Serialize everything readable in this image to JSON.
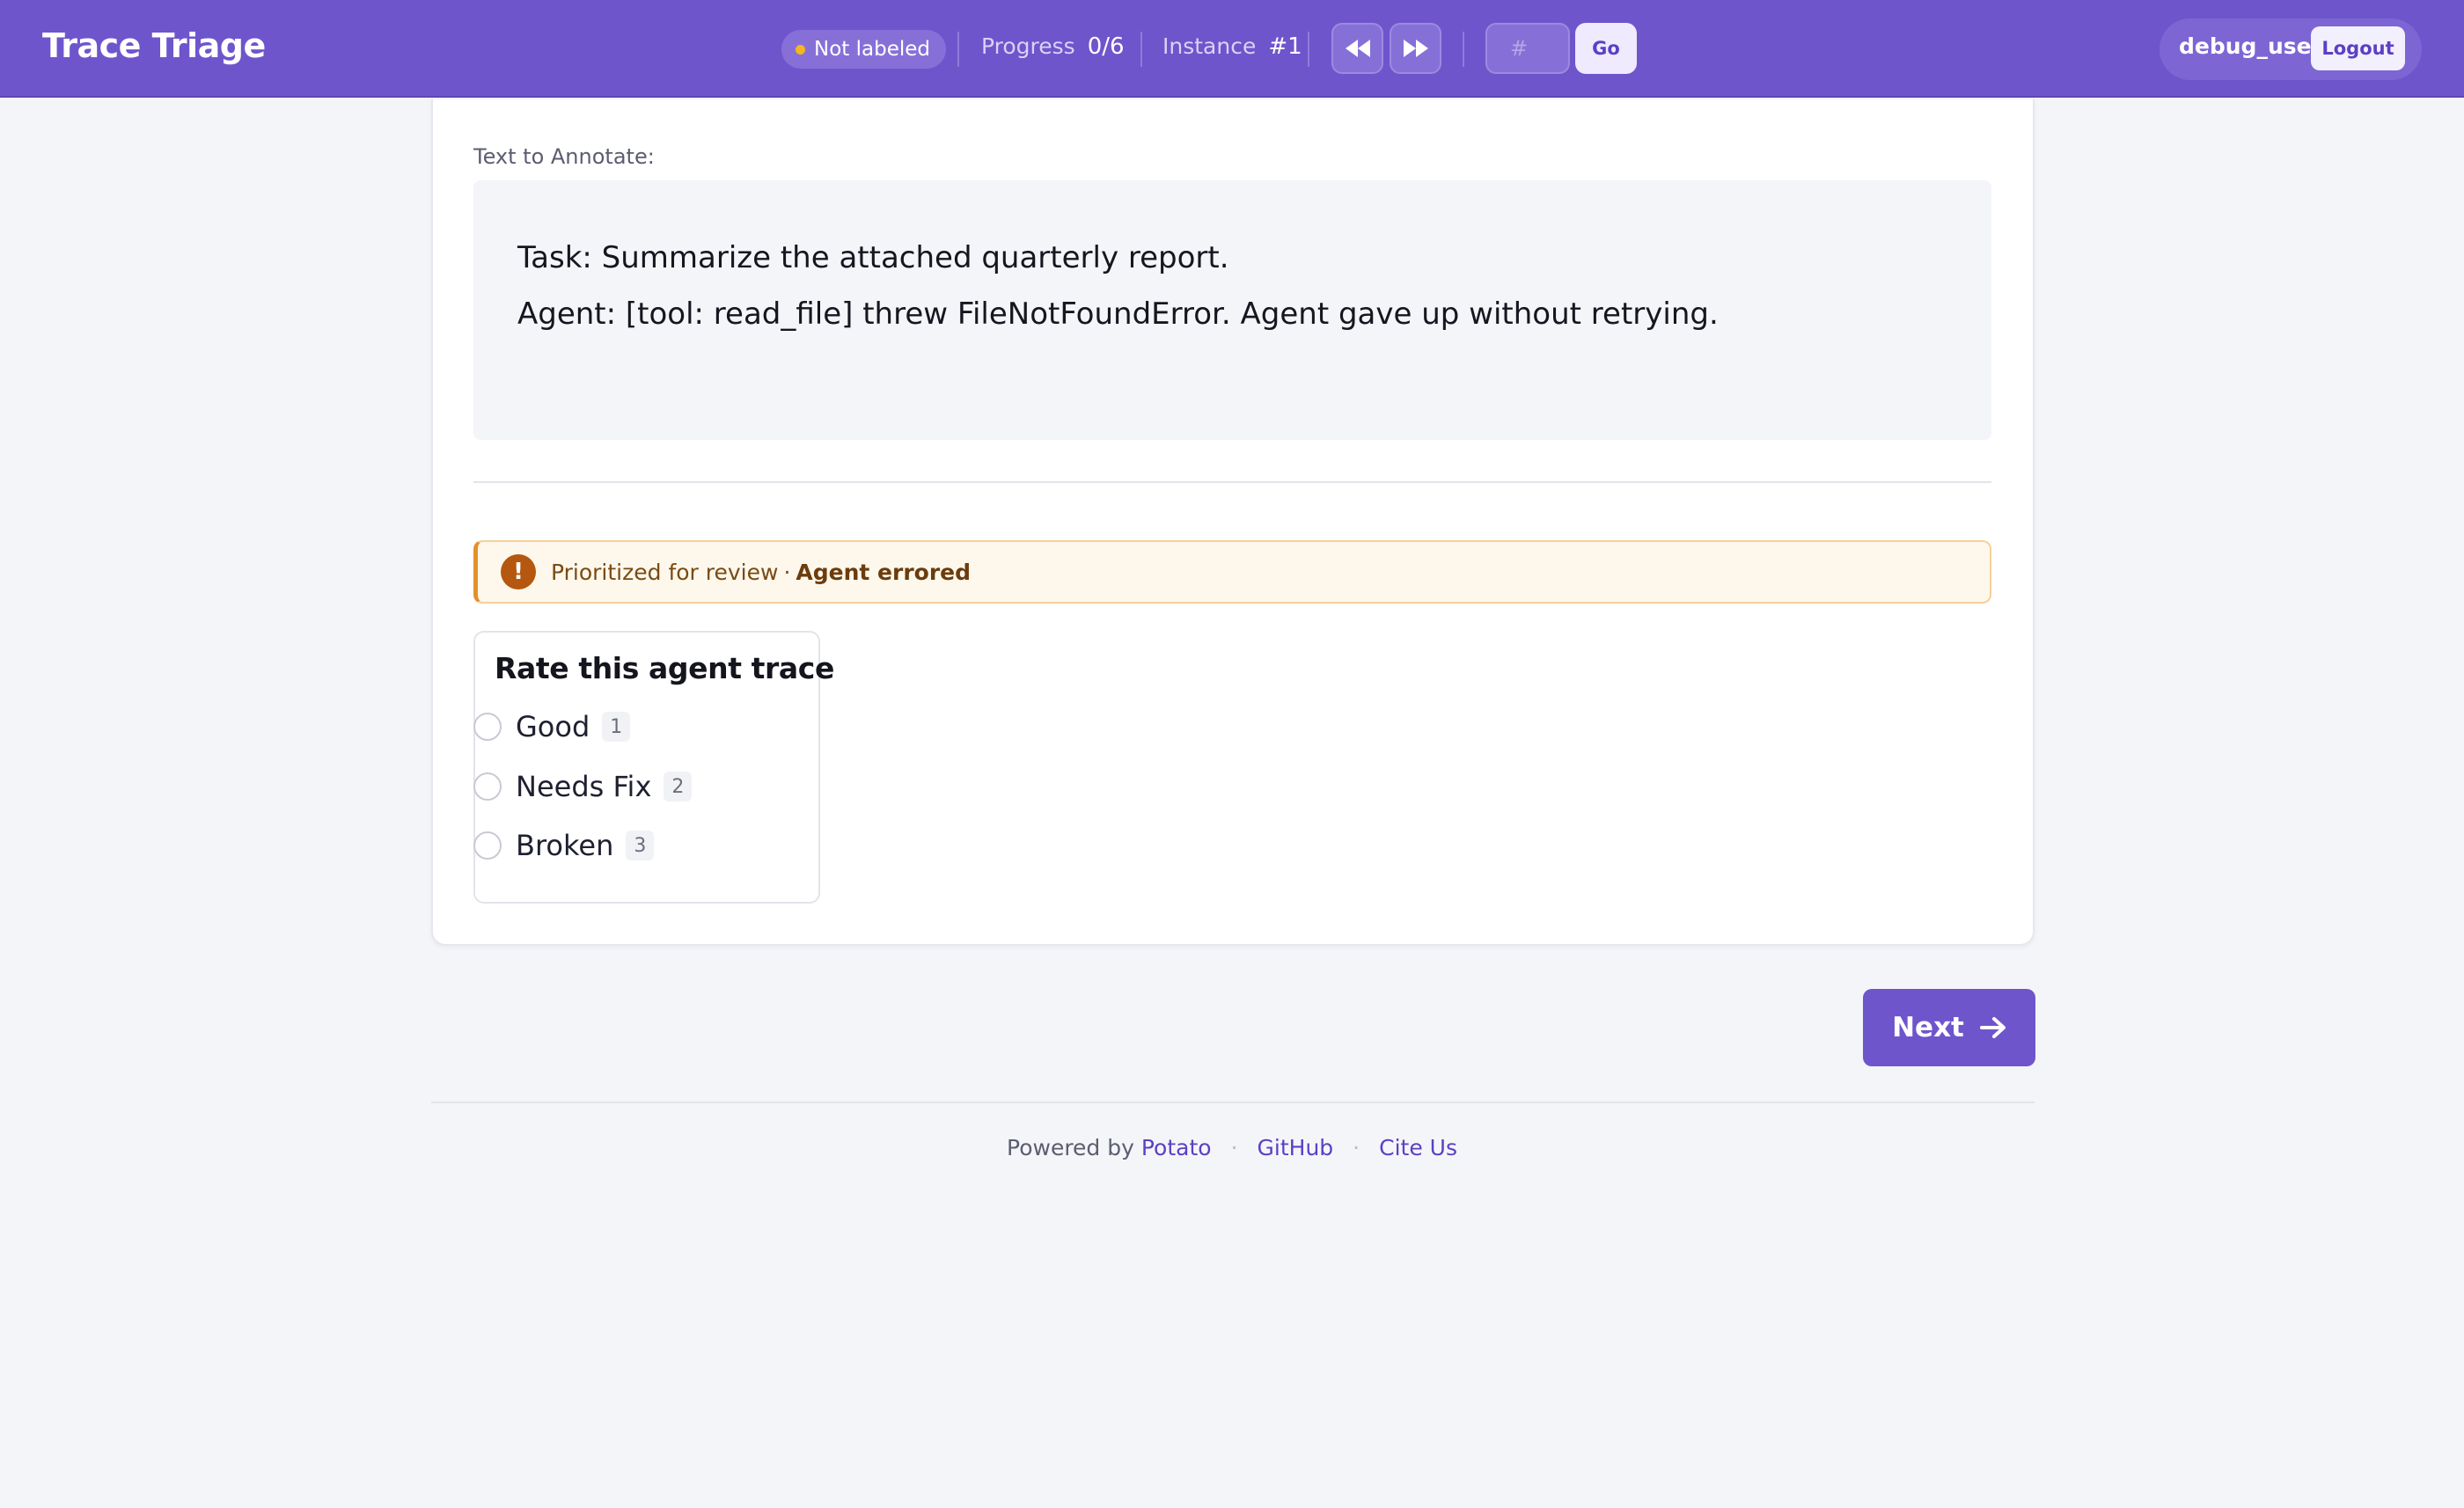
{
  "header": {
    "brand": "Trace Triage",
    "status": "Not labeled",
    "progress_label": "Progress",
    "progress_value": "0/6",
    "instance_label": "Instance",
    "instance_value": "#1",
    "jump_placeholder": "#",
    "go_label": "Go",
    "username": "debug_user",
    "logout_label": "Logout"
  },
  "annotation": {
    "section_label": "Text to Annotate:",
    "lines": [
      "Task: Summarize the attached quarterly report.",
      "Agent: [tool: read_file] threw FileNotFoundError. Agent gave up without retrying."
    ]
  },
  "priority": {
    "text": "Prioritized for review",
    "separator": "·",
    "reason": "Agent errored"
  },
  "rating": {
    "title": "Rate this agent trace",
    "options": [
      {
        "label": "Good",
        "key": "1"
      },
      {
        "label": "Needs Fix",
        "key": "2"
      },
      {
        "label": "Broken",
        "key": "3"
      }
    ]
  },
  "next_label": "Next",
  "footer": {
    "powered_by": "Powered by",
    "potato": "Potato",
    "github": "GitHub",
    "cite": "Cite Us",
    "separator": "·"
  },
  "colors": {
    "brand_purple": "#6f55cc",
    "status_dot": "#f6b61f",
    "warning_accent": "#e4902b"
  },
  "icons": {
    "status": "status-dot-icon",
    "prev": "rewind-icon",
    "next_nav": "fast-forward-icon",
    "warning": "exclamation-icon",
    "next_arrow": "arrow-right-icon"
  }
}
